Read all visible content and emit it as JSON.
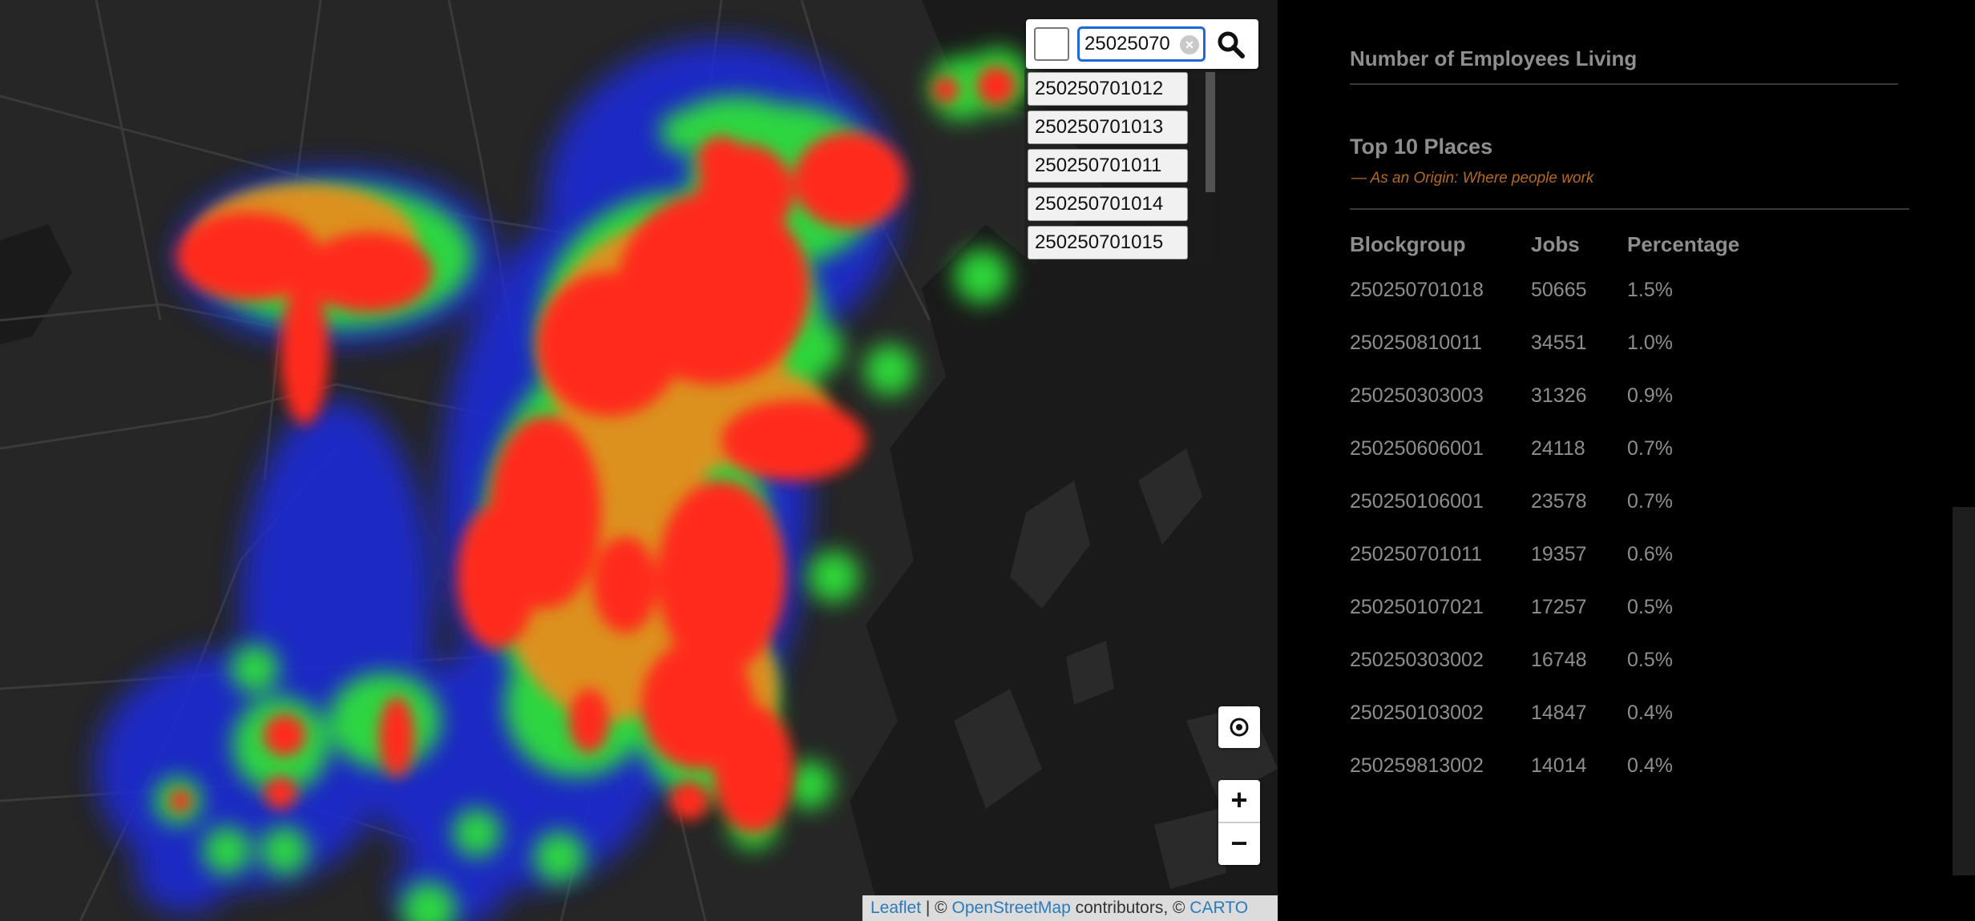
{
  "search": {
    "value": "25025070",
    "clear_symbol": "×",
    "suggestions": [
      "250250701012",
      "250250701013",
      "250250701011",
      "250250701014",
      "250250701015"
    ]
  },
  "map_controls": {
    "locate_symbol": "⊙",
    "zoom_in": "+",
    "zoom_out": "−"
  },
  "attribution": {
    "leaflet": "Leaflet",
    "sep1": " | © ",
    "osm": "OpenStreetMap",
    "mid": " contributors, © ",
    "carto": "CARTO"
  },
  "panel": {
    "title": "Number of Employees Living",
    "section_title": "Top 10 Places",
    "subtitle": "—  As an Origin: Where people work",
    "columns": [
      "Blockgroup",
      "Jobs",
      "Percentage"
    ],
    "rows": [
      [
        "250250701018",
        "50665",
        "1.5%"
      ],
      [
        "250250810011",
        "34551",
        "1.0%"
      ],
      [
        "250250303003",
        "31326",
        "0.9%"
      ],
      [
        "250250606001",
        "24118",
        "0.7%"
      ],
      [
        "250250106001",
        "23578",
        "0.7%"
      ],
      [
        "250250701011",
        "19357",
        "0.6%"
      ],
      [
        "250250107021",
        "17257",
        "0.5%"
      ],
      [
        "250250303002",
        "16748",
        "0.5%"
      ],
      [
        "250250103002",
        "14847",
        "0.4%"
      ],
      [
        "250259813002",
        "14014",
        "0.4%"
      ]
    ]
  },
  "colors": {
    "heat_low": "#0000ff",
    "heat_mid": "#00ff00",
    "heat_high": "#ff0000",
    "subtitle": "#b56a1e",
    "link": "#2a7bbd"
  }
}
